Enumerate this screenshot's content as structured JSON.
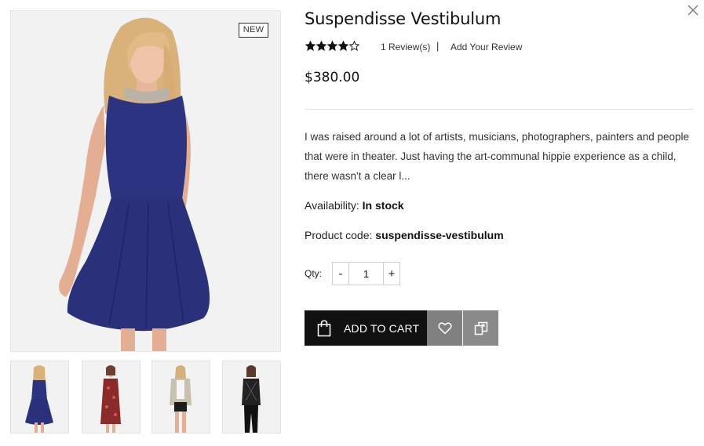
{
  "product": {
    "title": "Suspendisse Vestibulum",
    "badge": "NEW",
    "rating": 4,
    "rating_max": 5,
    "review_count_text": "1 Review(s)",
    "review_separator": "|",
    "add_review_label": "Add Your Review",
    "price": "$380.00",
    "description": "I was raised around a lot of artists, musicians, photographers, painters and people that were in theater. Just having the art-communal hippie experience as a child, there wasn't a clear l...",
    "availability_label": "Availability:",
    "availability_value": "In stock",
    "code_label": "Product code:",
    "code_value": "suspendisse-vestibulum"
  },
  "quantity": {
    "label": "Qty:",
    "minus": "-",
    "plus": "+",
    "value": "1"
  },
  "actions": {
    "add_to_cart_label": "ADD TO CART",
    "wishlist_icon": "heart-icon",
    "compare_icon": "compare-icon",
    "close_icon": "close-icon"
  },
  "gallery": {
    "thumbnails": [
      "navy-dress",
      "red-floral-dress",
      "jacket-shorts",
      "black-lace-top"
    ]
  },
  "colors": {
    "primary_button": "#111111",
    "secondary_button": "#808080",
    "dress_navy": "#2c3380"
  }
}
